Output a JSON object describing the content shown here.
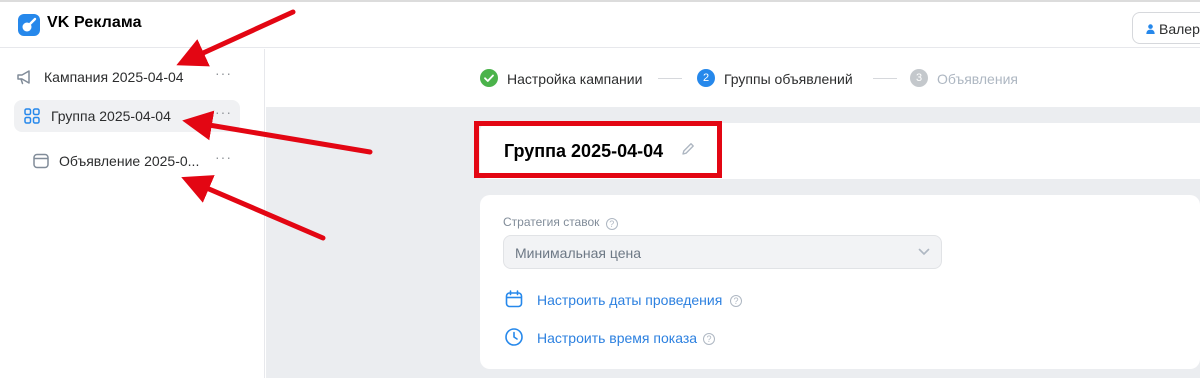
{
  "header": {
    "app_title": "VK Реклама",
    "user_name": "Валер"
  },
  "sidebar": {
    "items": [
      {
        "label": "Кампания 2025-04-04",
        "icon": "megaphone-icon",
        "more": "···"
      },
      {
        "label": "Группа 2025-04-04",
        "icon": "grid-icon",
        "more": "···"
      },
      {
        "label": "Объявление 2025-0...",
        "icon": "ad-card-icon",
        "more": "···"
      }
    ]
  },
  "stepper": {
    "steps": [
      {
        "number": "",
        "label": "Настройка кампании",
        "status": "done"
      },
      {
        "number": "2",
        "label": "Группы объявлений",
        "status": "active"
      },
      {
        "number": "3",
        "label": "Объявления",
        "status": "pending"
      }
    ]
  },
  "group": {
    "title": "Группа 2025-04-04"
  },
  "form": {
    "bid_strategy_label": "Стратегия ставок",
    "help_glyph": "?",
    "bid_strategy_value": "Минимальная цена",
    "dates_link": "Настроить даты проведения",
    "time_link": "Настроить время показа"
  },
  "colors": {
    "accent": "#2688eb",
    "link": "#2d81e0",
    "success": "#4bb34b",
    "annotation_red": "#e30613"
  }
}
